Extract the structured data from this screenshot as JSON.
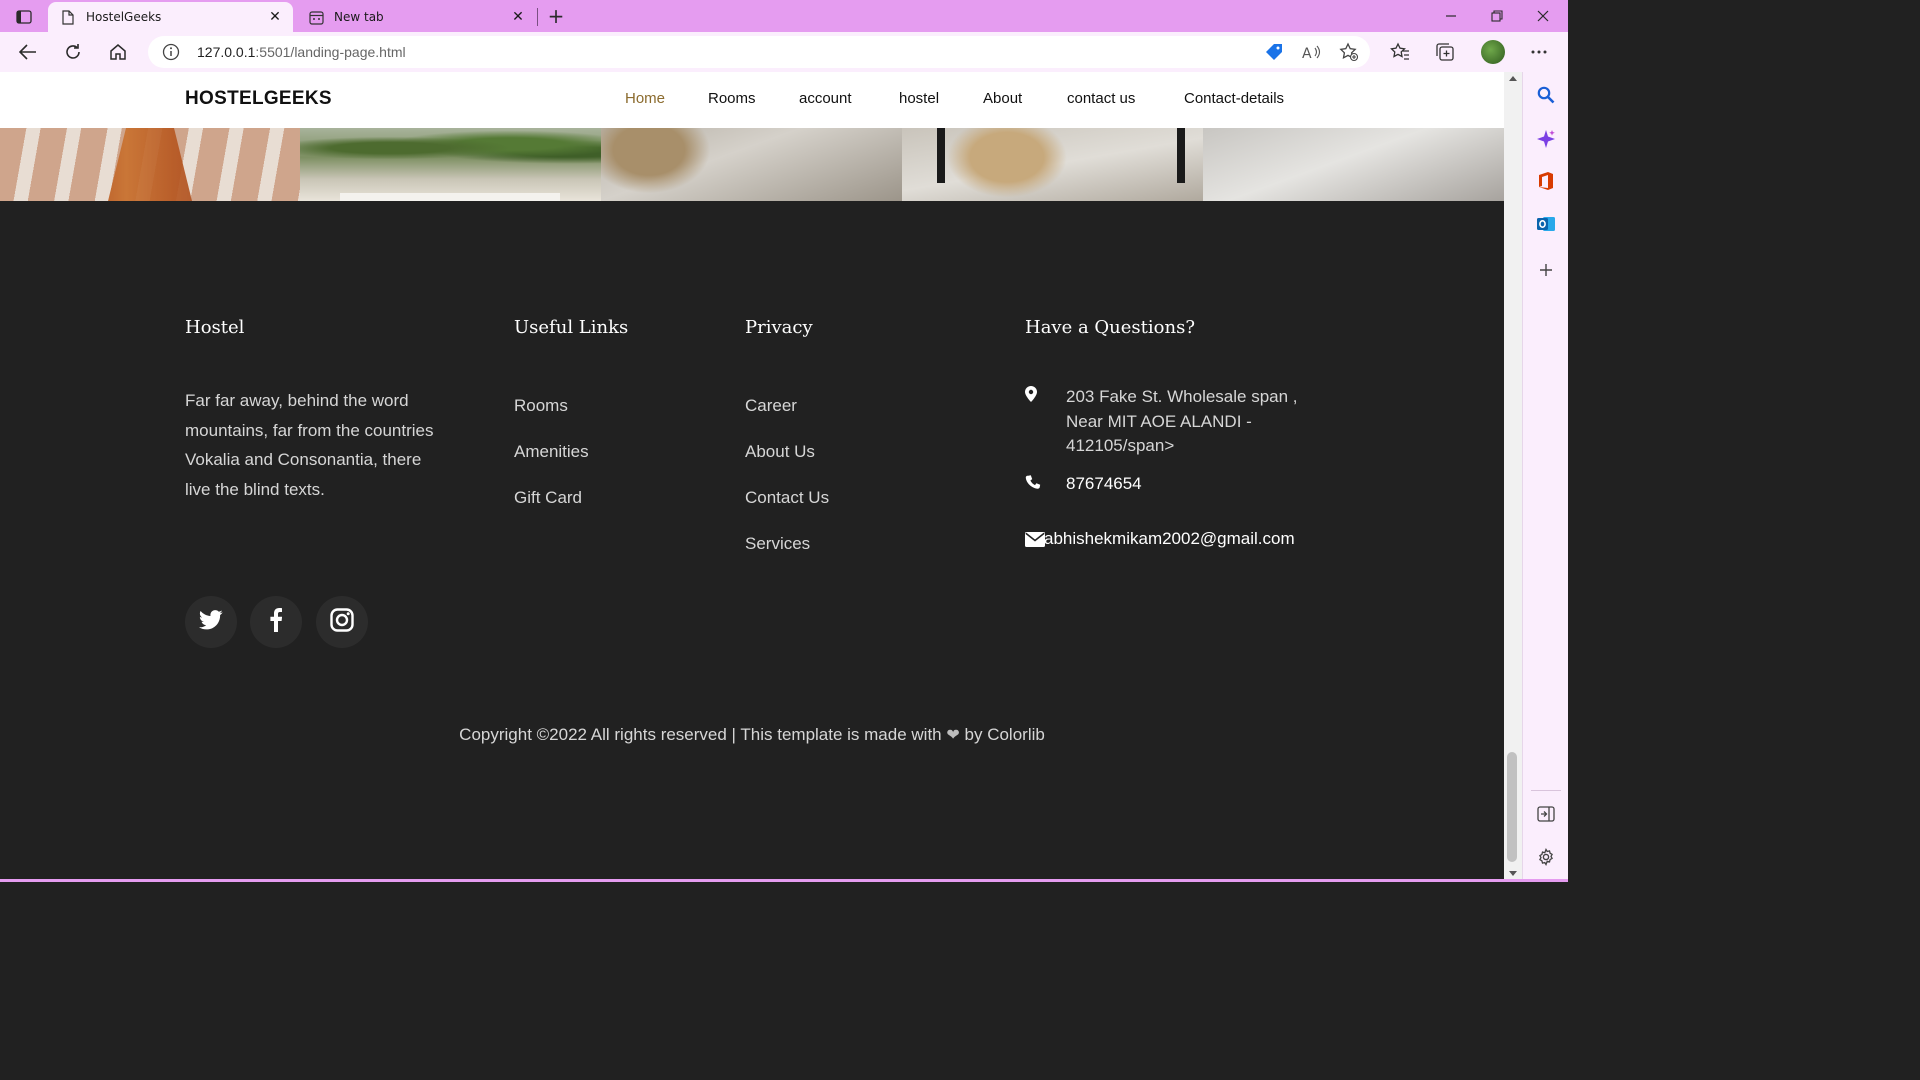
{
  "browser": {
    "tabs": [
      {
        "title": "HostelGeeks",
        "active": true
      },
      {
        "title": "New tab",
        "active": false
      }
    ],
    "address": {
      "host": "127.0.0.1",
      "rest": ":5501/landing-page.html"
    },
    "accent": "#e59cf0"
  },
  "site": {
    "brand": "HOSTELGEEKS",
    "nav": [
      {
        "label": "Home",
        "active": true
      },
      {
        "label": "Rooms"
      },
      {
        "label": "account"
      },
      {
        "label": "hostel"
      },
      {
        "label": "About"
      },
      {
        "label": "contact us"
      },
      {
        "label": "Contact-details"
      }
    ],
    "active_color": "#8b6b2e"
  },
  "footer": {
    "about": {
      "heading": "Hostel",
      "text": "Far far away, behind the word mountains, far from the countries Vokalia and Consonantia, there live the blind texts."
    },
    "useful_links": {
      "heading": "Useful Links",
      "items": [
        "Rooms",
        "Amenities",
        "Gift Card"
      ]
    },
    "privacy": {
      "heading": "Privacy",
      "items": [
        "Career",
        "About Us",
        "Contact Us",
        "Services"
      ]
    },
    "questions": {
      "heading": "Have a Questions?",
      "address_line1": "203 Fake St. Wholesale span ,",
      "address_line2": "Near MIT AOE ALANDI -",
      "address_line3": "412105/span>",
      "phone": "87674654",
      "email": "abhishekmikam2002@gmail.com"
    },
    "social": [
      "twitter-icon",
      "facebook-icon",
      "instagram-icon"
    ],
    "copyright_before": "Copyright ©2022 All rights reserved | This template is made with",
    "copyright_after": "by Colorlib",
    "background": "#212121"
  }
}
